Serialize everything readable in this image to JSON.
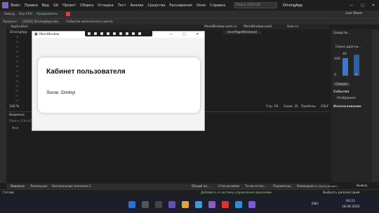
{
  "menubar": {
    "items": [
      "Файл",
      "Правка",
      "Вид",
      "Git",
      "Проект",
      "Сборка",
      "Отладка",
      "Тест",
      "Анализ",
      "Средства",
      "Расширения",
      "Окно",
      "Справка"
    ],
    "search_placeholder": "Поиск (Ctrl+Q)",
    "app_title": "DrivingApp",
    "window_buttons": [
      "—",
      "□",
      "✕"
    ]
  },
  "toolbar": {
    "config": "Debug",
    "platform": "Any CPU",
    "continue_label": "Продолжить",
    "live_share": "Live Share"
  },
  "toolbar2": {
    "process_label": "Процесс:",
    "process_value": "[2452] DrivingApp.exe",
    "lifecycle": "Событие жизненного цикла"
  },
  "editor_tabs": [
    "Application",
    "MainWindow.xaml.cs",
    "MainWindow.xaml",
    "User.cs"
  ],
  "editor_nav": {
    "left": "DrivingApp",
    "right": "UserPageWindow()"
  },
  "line_numbers": [
    "10",
    "11",
    "12",
    "13",
    "14",
    "15",
    "16",
    "17",
    "18",
    "19",
    "20",
    "21",
    "22",
    "23",
    "24",
    "25",
    "26",
    "27",
    "28",
    "29",
    "30"
  ],
  "right_panel": {
    "title": "Средств...",
    "section": "Сеанс диагно...",
    "tab1": "Сводка",
    "events": "События",
    "show": "Отображен",
    "usage": "Использование",
    "gauge_top": "40",
    "gauge_left": "100",
    "gauge_zero": "0",
    "gauge_zero2": "0"
  },
  "bottom_left": {
    "title": "Видимые",
    "search": "Поиск (Ctrl+E)",
    "header": "Имя"
  },
  "bottom_tabs": [
    "Видимые",
    "Локальные",
    "Контрольные значения 1",
    "Общий пр...",
    "Стек вызовов",
    "Точки остан...",
    "Параметры...",
    "Командное о...",
    "Окно интерп...",
    "Вывод"
  ],
  "status": {
    "ready": "Готово",
    "zoom": "100 %",
    "no_issues": "Проблемы не найдены",
    "line": "Стр: 29",
    "char": "Симв: 35",
    "spaces": "Пробелы",
    "crlf": "CRLF",
    "add_source": "Добавить в систему управления версиями",
    "repo": "Выбрать репозиторий"
  },
  "taskbar": {
    "lang": "ENG",
    "time": "00:21",
    "date": "18.06.2022"
  },
  "app_window": {
    "title": "MainWindow",
    "card_title": "Кабинет пользователя",
    "login_text": "Логин :Dmitryi"
  },
  "colors": {
    "vs_purple": "#865fc5",
    "editor_bg": "#1e1e1e",
    "window_bg": "#f3f3f3"
  }
}
